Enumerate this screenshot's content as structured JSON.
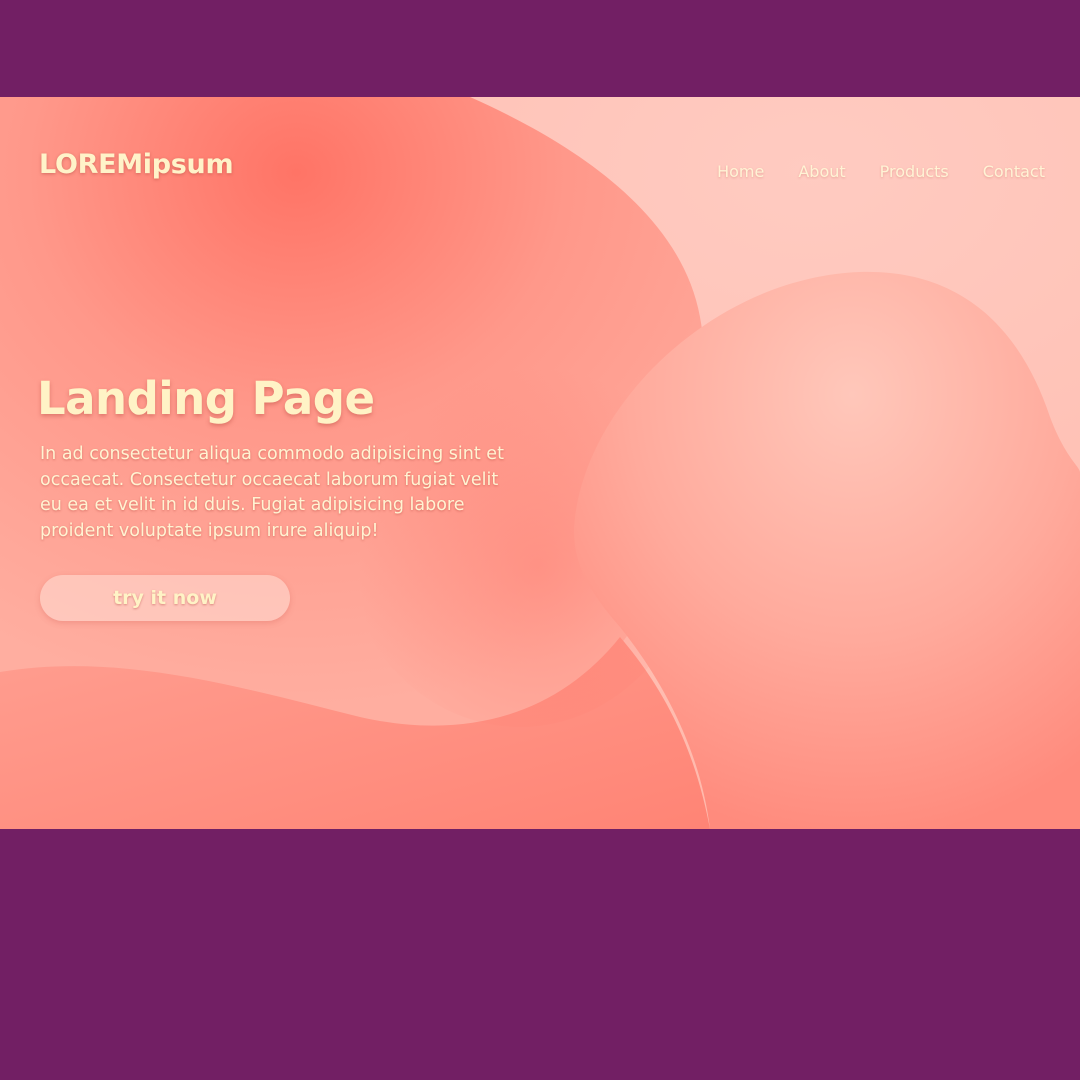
{
  "brand": {
    "logo_text": "LOREMipsum"
  },
  "nav": {
    "items": [
      {
        "label": "Home"
      },
      {
        "label": "About"
      },
      {
        "label": "Products"
      },
      {
        "label": "Contact"
      }
    ]
  },
  "hero": {
    "title": "Landing Page",
    "description": "In ad consectetur aliqua commodo adipisicing sint et occaecat. Consectetur occaecat laborum fugiat velit eu ea et velit in id duis. Fugiat adipisicing labore proident voluptate ipsum irure aliquip!",
    "cta_label": "try it now"
  },
  "colors": {
    "outer_background": "#721f64",
    "text_cream": "#fff3c6",
    "blob_light": "#ffc2b6",
    "blob_coral": "#ff7a6c"
  }
}
